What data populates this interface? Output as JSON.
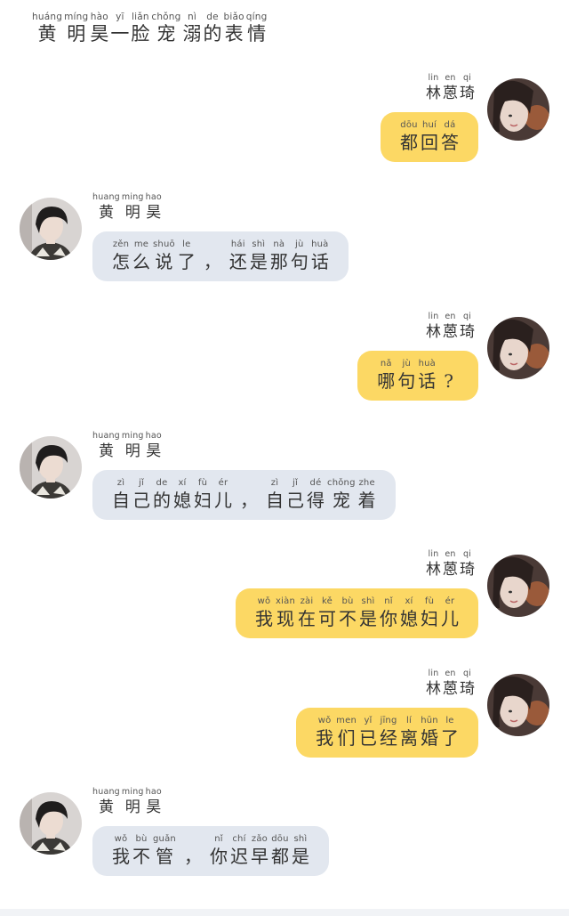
{
  "title": [
    {
      "py": "huáng",
      "hz": "黄"
    },
    {
      "py": "míng",
      "hz": "明"
    },
    {
      "py": "hào",
      "hz": "昊"
    },
    {
      "py": "yī",
      "hz": "一"
    },
    {
      "py": "liǎn",
      "hz": "脸"
    },
    {
      "py": "chǒng",
      "hz": "宠"
    },
    {
      "py": "nì",
      "hz": "溺"
    },
    {
      "py": "de",
      "hz": "的"
    },
    {
      "py": "biǎo",
      "hz": "表"
    },
    {
      "py": "qíng",
      "hz": "情"
    }
  ],
  "names": {
    "lin": [
      {
        "py": "lin",
        "hz": "林"
      },
      {
        "py": "en",
        "hz": "蒽"
      },
      {
        "py": "qi",
        "hz": "琦"
      }
    ],
    "huang": [
      {
        "py": "huang",
        "hz": "黄"
      },
      {
        "py": "ming",
        "hz": "明"
      },
      {
        "py": "hao",
        "hz": "昊"
      }
    ]
  },
  "messages": [
    {
      "side": "right",
      "speaker": "lin",
      "tokens": [
        {
          "py": "dōu",
          "hz": "都"
        },
        {
          "py": "huí",
          "hz": "回"
        },
        {
          "py": "dá",
          "hz": "答"
        }
      ]
    },
    {
      "side": "left",
      "speaker": "huang",
      "tokens": [
        {
          "py": "zěn",
          "hz": "怎"
        },
        {
          "py": "me",
          "hz": "么"
        },
        {
          "py": "shuō",
          "hz": "说"
        },
        {
          "py": "le",
          "hz": "了"
        },
        {
          "punct": "，"
        },
        {
          "py": "hái",
          "hz": "还"
        },
        {
          "py": "shì",
          "hz": "是"
        },
        {
          "py": "nà",
          "hz": "那"
        },
        {
          "py": "jù",
          "hz": "句"
        },
        {
          "py": "huà",
          "hz": "话"
        }
      ]
    },
    {
      "side": "right",
      "speaker": "lin",
      "tokens": [
        {
          "py": "nǎ",
          "hz": "哪"
        },
        {
          "py": "jù",
          "hz": "句"
        },
        {
          "py": "huà",
          "hz": "话"
        },
        {
          "punct": "?"
        }
      ]
    },
    {
      "side": "left",
      "speaker": "huang",
      "tokens": [
        {
          "py": "zì",
          "hz": "自"
        },
        {
          "py": "jǐ",
          "hz": "己"
        },
        {
          "py": "de",
          "hz": "的"
        },
        {
          "py": "xí",
          "hz": "媳"
        },
        {
          "py": "fù",
          "hz": "妇"
        },
        {
          "py": "ér",
          "hz": "儿"
        },
        {
          "punct": "，"
        },
        {
          "py": "zì",
          "hz": "自"
        },
        {
          "py": "jǐ",
          "hz": "己"
        },
        {
          "py": "dé",
          "hz": "得"
        },
        {
          "py": "chǒng",
          "hz": "宠"
        },
        {
          "py": "zhe",
          "hz": "着"
        }
      ]
    },
    {
      "side": "right",
      "speaker": "lin",
      "tokens": [
        {
          "py": "wǒ",
          "hz": "我"
        },
        {
          "py": "xiàn",
          "hz": "现"
        },
        {
          "py": "zài",
          "hz": "在"
        },
        {
          "py": "kě",
          "hz": "可"
        },
        {
          "py": "bù",
          "hz": "不"
        },
        {
          "py": "shì",
          "hz": "是"
        },
        {
          "py": "nǐ",
          "hz": "你"
        },
        {
          "py": "xí",
          "hz": "媳"
        },
        {
          "py": "fù",
          "hz": "妇"
        },
        {
          "py": "ér",
          "hz": "儿"
        }
      ]
    },
    {
      "side": "right",
      "speaker": "lin",
      "tokens": [
        {
          "py": "wǒ",
          "hz": "我"
        },
        {
          "py": "men",
          "hz": "们"
        },
        {
          "py": "yǐ",
          "hz": "已"
        },
        {
          "py": "jīng",
          "hz": "经"
        },
        {
          "py": "lí",
          "hz": "离"
        },
        {
          "py": "hūn",
          "hz": "婚"
        },
        {
          "py": "le",
          "hz": "了"
        }
      ]
    },
    {
      "side": "left",
      "speaker": "huang",
      "tokens": [
        {
          "py": "wǒ",
          "hz": "我"
        },
        {
          "py": "bù",
          "hz": "不"
        },
        {
          "py": "guǎn",
          "hz": "管"
        },
        {
          "punct": "，"
        },
        {
          "py": "nǐ",
          "hz": "你"
        },
        {
          "py": "chí",
          "hz": "迟"
        },
        {
          "py": "zǎo",
          "hz": "早"
        },
        {
          "py": "dōu",
          "hz": "都"
        },
        {
          "py": "shì",
          "hz": "是"
        }
      ]
    }
  ],
  "colors": {
    "right_bubble": "#fcd864",
    "left_bubble": "#e2e7ef"
  }
}
